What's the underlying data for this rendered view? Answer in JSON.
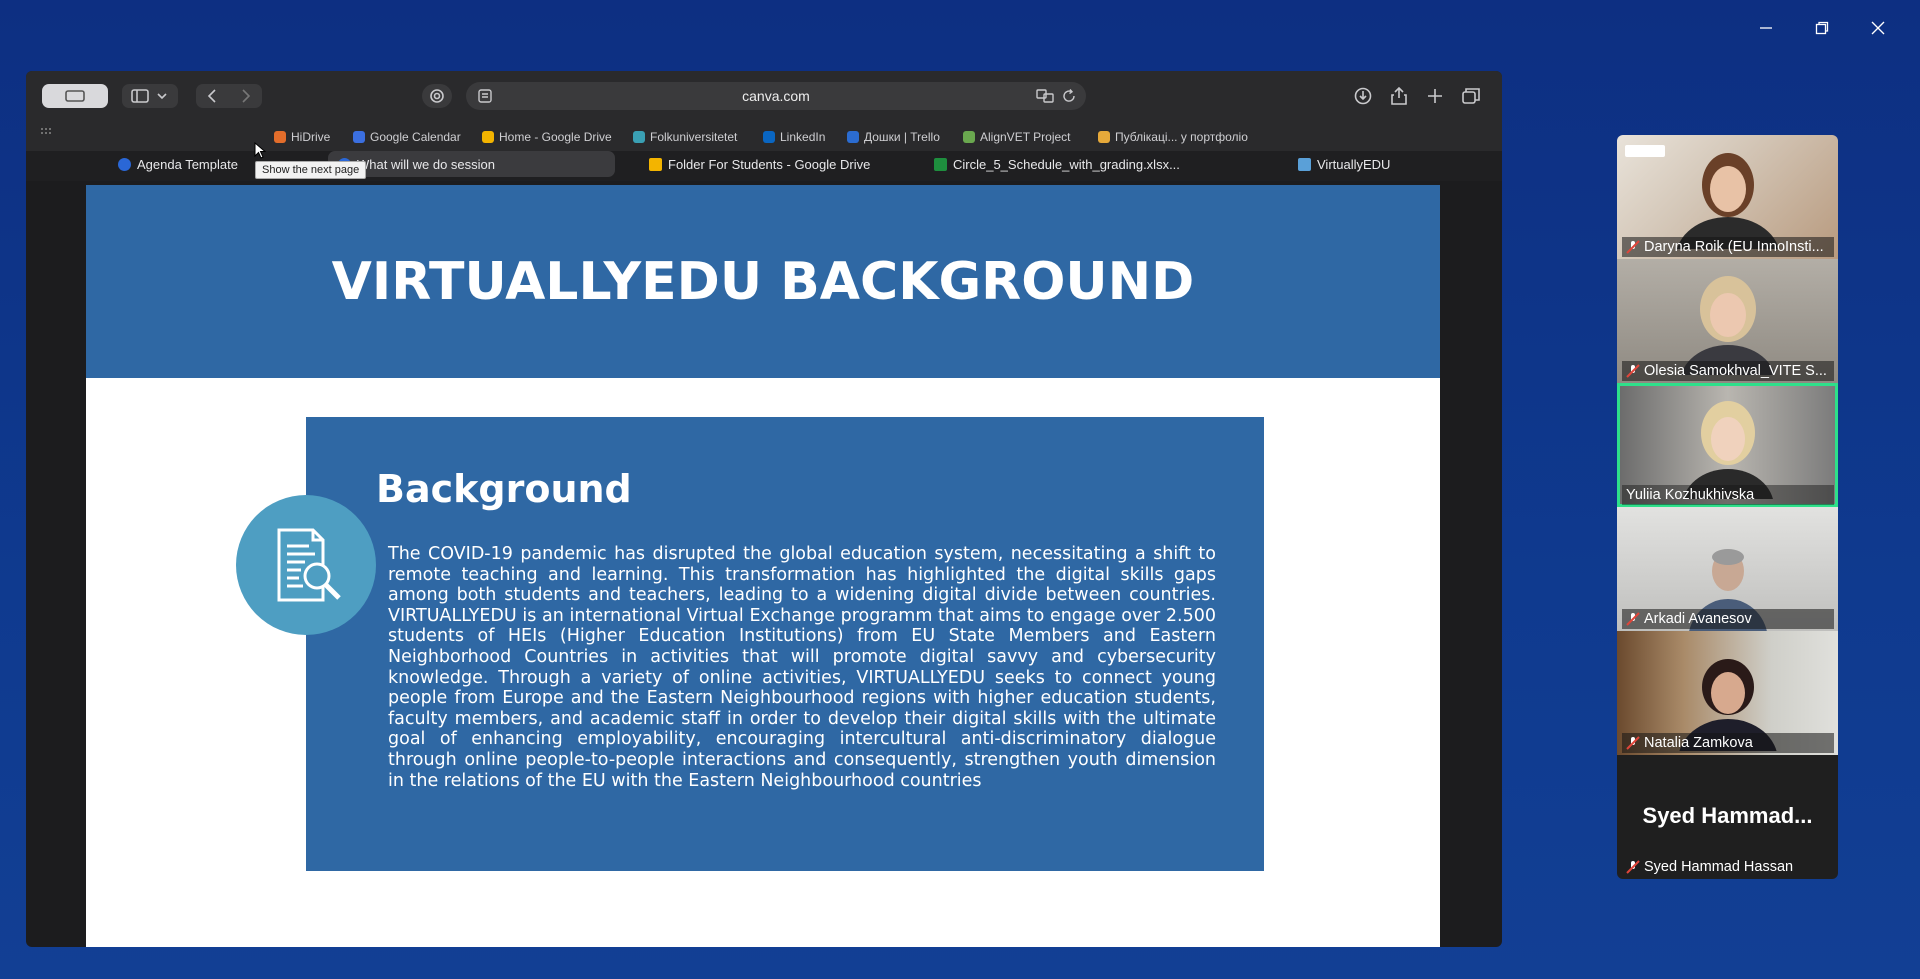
{
  "browser": {
    "address": "canva.com",
    "bookmarks": [
      {
        "label": "HiDrive",
        "color": "#e36d2b"
      },
      {
        "label": "Google Calendar",
        "color": "#3b6fe0"
      },
      {
        "label": "Home - Google Drive",
        "color": "#f3b400"
      },
      {
        "label": "Folkuniversitetet",
        "color": "#3aa0b4"
      },
      {
        "label": "LinkedIn",
        "color": "#0a66c2"
      },
      {
        "label": "Дошки | Trello",
        "color": "#2b6cd1"
      },
      {
        "label": "AlignVET Project",
        "color": "#6aa84f"
      },
      {
        "label": "Публікаці... у портфоліо",
        "color": "#e6a93a"
      }
    ],
    "tabs": [
      {
        "label": "Agenda Template",
        "color": "#2a67d6"
      },
      {
        "label": "What will we do session",
        "color": "#2a67d6"
      },
      {
        "label": "Folder For Students - Google Drive",
        "color": "#f3b400"
      },
      {
        "label": "Circle_5_Schedule_with_grading.xlsx...",
        "color": "#1e8e3e"
      },
      {
        "label": "VirtuallyEDU",
        "color": "#5aa0d8"
      }
    ],
    "tooltip": "Show the next page"
  },
  "slide": {
    "title": "VIRTUALLYEDU BACKGROUND",
    "heading": "Background",
    "body": "The COVID-19 pandemic has disrupted the global education system, necessitating a shift to remote teaching and learning. This transformation has highlighted the digital skills gaps among both students and teachers, leading to a widening digital divide between countries. VIRTUALLYEDU is an international Virtual Exchange programm that aims to engage over 2.500 students of HEIs (Higher Education Institutions) from EU State Members and Eastern Neighborhood Countries in activities that will promote digital savvy and cybersecurity knowledge. Through a variety of online activities, VIRTUALLYEDU seeks to connect young people from Europe and the Eastern Neighbourhood regions with higher education students, faculty members, and academic staff in order to develop their digital skills with the ultimate goal of enhancing employability, encouraging intercultural anti-discriminatory dialogue through online people-to-people interactions and consequently, strengthen youth dimension in the relations of the EU with the Eastern Neighbourhood countries"
  },
  "participants": [
    {
      "name": "Daryna Roik (EU InnoInsti...",
      "muted": true
    },
    {
      "name": "Olesia Samokhval_VITE S...",
      "muted": true
    },
    {
      "name": "Yuliia Kozhukhivska",
      "muted": false,
      "speaking": true
    },
    {
      "name": "Arkadi Avanesov",
      "muted": true
    },
    {
      "name": "Natalia Zamkova",
      "muted": true
    },
    {
      "name": "Syed Hammad Hassan",
      "muted": true,
      "display_text": "Syed  Hammad..."
    }
  ],
  "colors": {
    "slide_blue": "#2f68a4",
    "icon_circle": "#4e9ec2",
    "speaking_border": "#2ee08a",
    "mute_red": "#e0453a"
  }
}
